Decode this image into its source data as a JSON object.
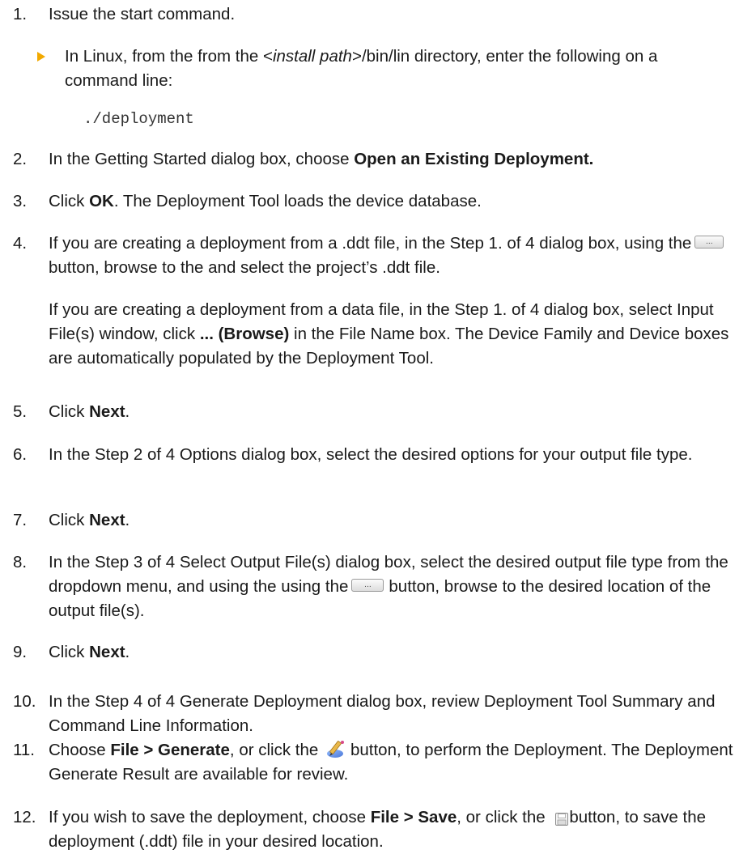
{
  "steps": [
    {
      "num": "1.",
      "text": "Issue the start command.",
      "bullet": {
        "pre": "In Linux, from the from the <",
        "em": "install path",
        "post": ">/bin/lin directory, enter the following on a command line:"
      },
      "code": "./deployment"
    },
    {
      "num": "2.",
      "pre": "In the Getting Started dialog box, choose ",
      "bold": "Open an Existing Deployment.",
      "post": ""
    },
    {
      "num": "3.",
      "pre": "Click ",
      "bold": "OK",
      "post": ". The Deployment Tool loads the device database."
    },
    {
      "num": "4.",
      "pre": "If you are creating a deployment from a .ddt file, in the Step 1. of 4 dialog box, using the",
      "post": "button, browse to the and select the project’s .ddt file.",
      "p2_pre": "If you are creating a deployment from a data file, in the Step 1. of 4 dialog box, select Input File(s) window, click ",
      "p2_bold": "... (Browse)",
      "p2_post": " in the File Name box. The Device Family and Device boxes are automatically populated by the Deployment Tool."
    },
    {
      "num": "5.",
      "pre": "Click ",
      "bold": "Next",
      "post": "."
    },
    {
      "num": "6.",
      "text": "In the Step 2 of 4 Options dialog box, select the desired options for your output file type."
    },
    {
      "num": "7.",
      "pre": "Click ",
      "bold": "Next",
      "post": "."
    },
    {
      "num": "8.",
      "pre": "In the Step 3 of 4 Select Output File(s) dialog box, select the desired output file type from the dropdown menu, and using the using the",
      "post": "button, browse to the desired location of the output file(s)."
    },
    {
      "num": "9.",
      "pre": "Click ",
      "bold": "Next",
      "post": "."
    },
    {
      "num": "10.",
      "text": "In the Step 4 of 4 Generate Deployment dialog box, review Deployment Tool Summary and Command Line Information."
    },
    {
      "num": "11.",
      "pre": "Choose ",
      "bold": "File > Generate",
      "mid": ", or click the",
      "post": "button, to perform the Deployment. The Deployment Generate Result are available for review."
    },
    {
      "num": "12.",
      "pre": "If you wish to save the deployment, choose ",
      "bold": "File > Save",
      "mid": ", or click the",
      "post": "button, to save the deployment (.ddt) file in your desired location."
    }
  ],
  "icons": {
    "ellipsis_button_label": "...",
    "bullet_color": "#f2a900",
    "generate_icon": "pencil-wand-icon",
    "save_icon": "floppy-disk-icon"
  }
}
